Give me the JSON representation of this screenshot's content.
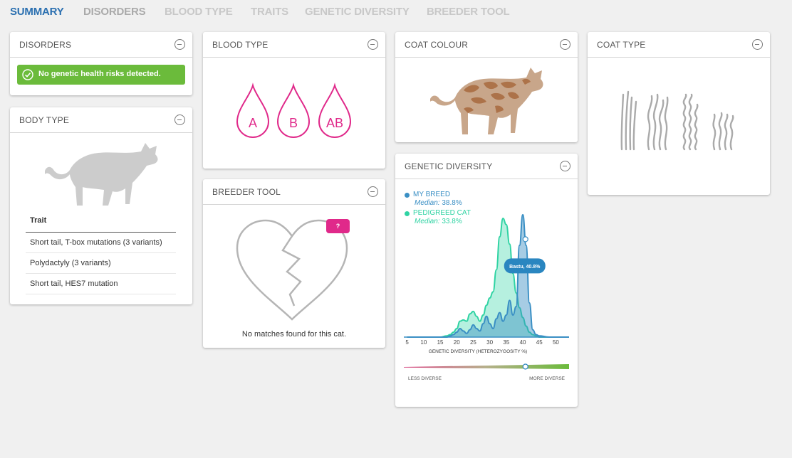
{
  "tabs": [
    {
      "label": "SUMMARY",
      "state": "active"
    },
    {
      "label": "DISORDERS",
      "state": "dim"
    },
    {
      "label": "BLOOD TYPE",
      "state": "inactive"
    },
    {
      "label": "TRAITS",
      "state": "inactive"
    },
    {
      "label": "GENETIC DIVERSITY",
      "state": "inactive"
    },
    {
      "label": "BREEDER TOOL",
      "state": "inactive"
    }
  ],
  "disorders": {
    "title": "DISORDERS",
    "status_text": "No genetic health risks detected.",
    "status_color": "#6bbb3b"
  },
  "body_type": {
    "title": "BODY TYPE",
    "table_header": "Trait",
    "traits": [
      "Short tail, T-box mutations (3 variants)",
      "Polydactyly (3 variants)",
      "Short tail, HES7 mutation"
    ]
  },
  "blood_type": {
    "title": "BLOOD TYPE",
    "types": [
      "A",
      "B",
      "AB"
    ],
    "color": "#e0298a"
  },
  "breeder_tool": {
    "title": "BREEDER TOOL",
    "badge": "?",
    "message": "No matches found for this cat."
  },
  "coat_colour": {
    "title": "COAT COLOUR"
  },
  "coat_type": {
    "title": "COAT TYPE"
  },
  "genetic_diversity": {
    "title": "GENETIC DIVERSITY",
    "less_label": "LESS DIVERSE",
    "more_label": "MORE DIVERSE",
    "slider_value_percent": 40.8
  },
  "chart_data": {
    "type": "area",
    "xlabel": "GENETIC DIVERSITY (HETEROZYGOSITY %)",
    "xlim": [
      4,
      54
    ],
    "xticks": [
      5,
      10,
      15,
      20,
      25,
      30,
      35,
      40,
      45,
      50
    ],
    "series": [
      {
        "name": "MY BREED",
        "median_label": "Median:",
        "median_value": "38.8%",
        "color": "#3a8fc4",
        "x": [
          5,
          10,
          15,
          17,
          18,
          19,
          20,
          21,
          22,
          23,
          24,
          25,
          26,
          27,
          28,
          29,
          30,
          31,
          32,
          33,
          34,
          35,
          36,
          37,
          38,
          39,
          40,
          41,
          42,
          43,
          44,
          45,
          48,
          54
        ],
        "y": [
          0,
          0,
          0,
          0,
          0.01,
          0.02,
          0.04,
          0.07,
          0.05,
          0.03,
          0.06,
          0.1,
          0.07,
          0.05,
          0.11,
          0.17,
          0.11,
          0.07,
          0.15,
          0.2,
          0.13,
          0.18,
          0.3,
          0.18,
          0.25,
          0.75,
          1.0,
          0.75,
          0.28,
          0.06,
          0.02,
          0.01,
          0,
          0
        ]
      },
      {
        "name": "PEDIGREED CAT",
        "median_label": "Median:",
        "median_value": "33.8%",
        "color": "#2fd3a3",
        "x": [
          5,
          10,
          15,
          17,
          18,
          19,
          20,
          21,
          22,
          23,
          24,
          25,
          26,
          27,
          28,
          29,
          30,
          31,
          32,
          33,
          34,
          35,
          36,
          37,
          38,
          39,
          40,
          41,
          42,
          43,
          44,
          45,
          48,
          54
        ],
        "y": [
          0,
          0,
          0,
          0.01,
          0.02,
          0.04,
          0.07,
          0.13,
          0.14,
          0.13,
          0.19,
          0.21,
          0.17,
          0.13,
          0.18,
          0.26,
          0.32,
          0.37,
          0.55,
          0.82,
          0.97,
          0.92,
          0.76,
          0.52,
          0.36,
          0.24,
          0.16,
          0.09,
          0.04,
          0.02,
          0.01,
          0,
          0,
          0
        ]
      }
    ],
    "marker": {
      "x": 40.8,
      "label": "Bastu, 40.8%",
      "series": "MY BREED"
    }
  }
}
